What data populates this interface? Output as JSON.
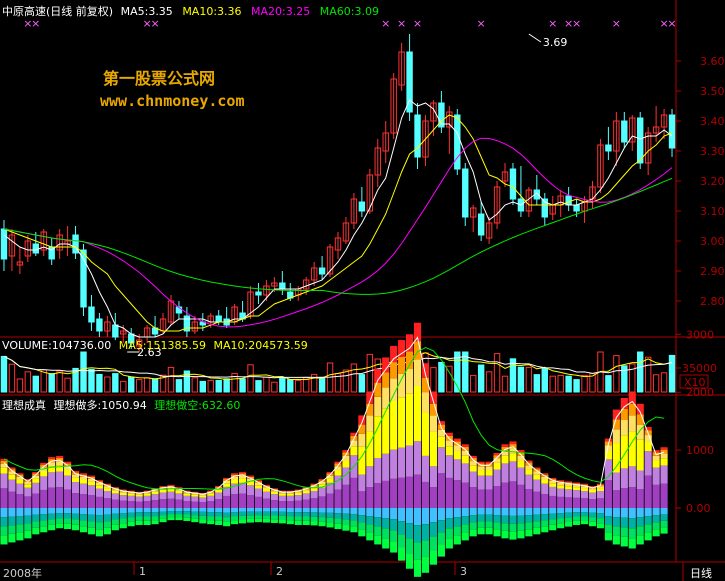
{
  "header": {
    "stock_title": "中原高速(日线 前复权)",
    "ma5": "MA5:3.35",
    "ma10": "MA10:3.36",
    "ma20": "MA20:3.25",
    "ma60": "MA60:3.09"
  },
  "watermark": {
    "line1": "第一股票公式网",
    "line2": "www.chnmoney.com"
  },
  "volume_header": {
    "volume": "VOLUME:104736.00",
    "ma5": "MA5:151385.59",
    "ma10": "MA10:204573.59"
  },
  "indicator_header": {
    "name": "理想成真",
    "long": "理想做多:1050.94",
    "short": "理想做空:632.60"
  },
  "bottom_bar": {
    "labels": [
      "2008年",
      "1",
      "2",
      "3"
    ],
    "period": "日线"
  },
  "colors": {
    "up": "#ff3232",
    "down": "#54ffff",
    "ma5": "#ffffff",
    "ma10": "#ffff00",
    "ma20": "#ff00ff",
    "ma60": "#00e600",
    "axis": "#b00000",
    "label": "#cccccc"
  },
  "chart_data": [
    {
      "type": "candlestick",
      "title": "中原高速(日线 前复权)",
      "annotations": [
        {
          "text": "3.69",
          "x": 66,
          "y": 3.69
        },
        {
          "text": "2.63",
          "x": 17,
          "y": 2.63
        }
      ],
      "ylim": [
        2.63,
        3.73
      ],
      "yticks": [
        2.8,
        2.9,
        3.0,
        3.1,
        3.2,
        3.3,
        3.4,
        3.5,
        3.6
      ],
      "ytick_labels": [
        "2.80",
        "2.90",
        "3.00",
        "3.10",
        "3.20",
        "3.30",
        "3.40",
        "3.50",
        "3.60"
      ],
      "candles": [
        [
          3.04,
          3.07,
          2.9,
          2.94
        ],
        [
          2.95,
          3.04,
          2.9,
          3.02
        ],
        [
          2.92,
          2.98,
          2.89,
          2.93
        ],
        [
          2.95,
          3.02,
          2.93,
          3.0
        ],
        [
          2.99,
          3.03,
          2.95,
          2.96
        ],
        [
          2.97,
          3.04,
          2.95,
          3.03
        ],
        [
          2.98,
          3.01,
          2.92,
          2.94
        ],
        [
          2.97,
          3.04,
          2.94,
          3.02
        ],
        [
          2.99,
          3.05,
          2.95,
          3.0
        ],
        [
          3.02,
          3.05,
          2.94,
          2.96
        ],
        [
          2.97,
          2.99,
          2.75,
          2.78
        ],
        [
          2.78,
          2.82,
          2.7,
          2.73
        ],
        [
          2.74,
          2.76,
          2.68,
          2.7
        ],
        [
          2.7,
          2.75,
          2.68,
          2.73
        ],
        [
          2.72,
          2.76,
          2.67,
          2.68
        ],
        [
          2.69,
          2.72,
          2.66,
          2.7
        ],
        [
          2.69,
          2.71,
          2.64,
          2.66
        ],
        [
          2.65,
          2.69,
          2.63,
          2.67
        ],
        [
          2.68,
          2.72,
          2.66,
          2.71
        ],
        [
          2.71,
          2.75,
          2.68,
          2.69
        ],
        [
          2.7,
          2.76,
          2.69,
          2.74
        ],
        [
          2.73,
          2.82,
          2.72,
          2.8
        ],
        [
          2.78,
          2.8,
          2.74,
          2.76
        ],
        [
          2.75,
          2.78,
          2.68,
          2.7
        ],
        [
          2.7,
          2.75,
          2.69,
          2.73
        ],
        [
          2.73,
          2.76,
          2.7,
          2.72
        ],
        [
          2.73,
          2.76,
          2.71,
          2.75
        ],
        [
          2.75,
          2.77,
          2.72,
          2.73
        ],
        [
          2.74,
          2.78,
          2.71,
          2.72
        ],
        [
          2.73,
          2.79,
          2.72,
          2.78
        ],
        [
          2.76,
          2.8,
          2.73,
          2.74
        ],
        [
          2.75,
          2.85,
          2.74,
          2.83
        ],
        [
          2.83,
          2.86,
          2.79,
          2.82
        ],
        [
          2.82,
          2.87,
          2.8,
          2.85
        ],
        [
          2.85,
          2.88,
          2.83,
          2.86
        ],
        [
          2.86,
          2.9,
          2.82,
          2.84
        ],
        [
          2.83,
          2.86,
          2.8,
          2.81
        ],
        [
          2.82,
          2.85,
          2.8,
          2.84
        ],
        [
          2.84,
          2.88,
          2.82,
          2.87
        ],
        [
          2.87,
          2.93,
          2.85,
          2.91
        ],
        [
          2.91,
          2.95,
          2.87,
          2.89
        ],
        [
          2.89,
          2.99,
          2.88,
          2.98
        ],
        [
          2.97,
          3.03,
          2.94,
          3.01
        ],
        [
          3.0,
          3.08,
          2.99,
          3.06
        ],
        [
          3.06,
          3.16,
          3.04,
          3.14
        ],
        [
          3.13,
          3.18,
          3.08,
          3.1
        ],
        [
          3.1,
          3.24,
          3.09,
          3.22
        ],
        [
          3.22,
          3.34,
          3.18,
          3.31
        ],
        [
          3.3,
          3.4,
          3.26,
          3.36
        ],
        [
          3.36,
          3.56,
          3.34,
          3.54
        ],
        [
          3.52,
          3.66,
          3.5,
          3.63
        ],
        [
          3.63,
          3.69,
          3.4,
          3.43
        ],
        [
          3.42,
          3.46,
          3.24,
          3.28
        ],
        [
          3.28,
          3.42,
          3.25,
          3.4
        ],
        [
          3.4,
          3.47,
          3.35,
          3.46
        ],
        [
          3.46,
          3.5,
          3.36,
          3.38
        ],
        [
          3.38,
          3.45,
          3.29,
          3.43
        ],
        [
          3.42,
          3.44,
          3.22,
          3.24
        ],
        [
          3.24,
          3.26,
          3.05,
          3.08
        ],
        [
          3.08,
          3.12,
          3.03,
          3.11
        ],
        [
          3.09,
          3.13,
          3.0,
          3.02
        ],
        [
          3.01,
          3.08,
          2.99,
          3.06
        ],
        [
          3.06,
          3.2,
          3.04,
          3.18
        ],
        [
          3.2,
          3.26,
          3.18,
          3.23
        ],
        [
          3.24,
          3.26,
          3.12,
          3.14
        ],
        [
          3.14,
          3.25,
          3.08,
          3.1
        ],
        [
          3.1,
          3.18,
          3.08,
          3.17
        ],
        [
          3.17,
          3.22,
          3.12,
          3.14
        ],
        [
          3.14,
          3.16,
          3.05,
          3.08
        ],
        [
          3.09,
          3.15,
          3.07,
          3.12
        ],
        [
          3.12,
          3.17,
          3.08,
          3.15
        ],
        [
          3.15,
          3.18,
          3.1,
          3.12
        ],
        [
          3.12,
          3.14,
          3.08,
          3.1
        ],
        [
          3.1,
          3.15,
          3.06,
          3.13
        ],
        [
          3.14,
          3.2,
          3.11,
          3.18
        ],
        [
          3.18,
          3.34,
          3.16,
          3.32
        ],
        [
          3.32,
          3.38,
          3.27,
          3.3
        ],
        [
          3.3,
          3.43,
          3.25,
          3.4
        ],
        [
          3.4,
          3.43,
          3.31,
          3.33
        ],
        [
          3.33,
          3.42,
          3.3,
          3.41
        ],
        [
          3.41,
          3.43,
          3.24,
          3.26
        ],
        [
          3.26,
          3.38,
          3.22,
          3.36
        ],
        [
          3.36,
          3.45,
          3.33,
          3.38
        ],
        [
          3.38,
          3.44,
          3.34,
          3.42
        ],
        [
          3.42,
          3.44,
          3.28,
          3.31
        ]
      ],
      "ma5": [
        3.02,
        3.0,
        2.98,
        2.97,
        2.97,
        2.98,
        2.97,
        2.99,
        2.99,
        2.98,
        2.94,
        2.89,
        2.83,
        2.78,
        2.72,
        2.71,
        2.69,
        2.68,
        2.68,
        2.68,
        2.69,
        2.72,
        2.74,
        2.74,
        2.74,
        2.74,
        2.73,
        2.73,
        2.73,
        2.74,
        2.74,
        2.76,
        2.78,
        2.81,
        2.84,
        2.84,
        2.84,
        2.84,
        2.85,
        2.86,
        2.87,
        2.9,
        2.93,
        2.97,
        3.02,
        3.06,
        3.11,
        3.17,
        3.21,
        3.31,
        3.41,
        3.47,
        3.45,
        3.46,
        3.44,
        3.39,
        3.39,
        3.36,
        3.29,
        3.23,
        3.13,
        3.07,
        3.09,
        3.12,
        3.13,
        3.12,
        3.14,
        3.16,
        3.13,
        3.12,
        3.13,
        3.12,
        3.12,
        3.13,
        3.14,
        3.17,
        3.21,
        3.26,
        3.31,
        3.35,
        3.34,
        3.35,
        3.35,
        3.37,
        3.35
      ],
      "ma10": [
        3.04,
        3.03,
        3.02,
        3.01,
        3.0,
        2.99,
        2.98,
        2.98,
        2.98,
        2.98,
        2.96,
        2.93,
        2.91,
        2.89,
        2.85,
        2.82,
        2.79,
        2.76,
        2.73,
        2.71,
        2.7,
        2.7,
        2.7,
        2.71,
        2.71,
        2.71,
        2.72,
        2.73,
        2.73,
        2.73,
        2.74,
        2.75,
        2.75,
        2.77,
        2.79,
        2.8,
        2.81,
        2.82,
        2.83,
        2.84,
        2.85,
        2.87,
        2.89,
        2.91,
        2.93,
        2.95,
        2.99,
        3.04,
        3.09,
        3.16,
        3.23,
        3.29,
        3.31,
        3.34,
        3.37,
        3.4,
        3.42,
        3.41,
        3.38,
        3.34,
        3.28,
        3.22,
        3.21,
        3.19,
        3.18,
        3.15,
        3.12,
        3.12,
        3.12,
        3.12,
        3.12,
        3.13,
        3.14,
        3.13,
        3.13,
        3.14,
        3.16,
        3.19,
        3.22,
        3.25,
        3.27,
        3.3,
        3.32,
        3.35,
        3.36
      ]
    },
    {
      "type": "bar",
      "title": "VOLUME:104736.00",
      "series": [
        {
          "name": "MA5",
          "value_label": "MA5:151385.59"
        },
        {
          "name": "MA10",
          "value_label": "MA10:204573.59"
        }
      ],
      "yticks": [
        35000
      ],
      "ytick_labels": [
        "35000"
      ],
      "scale_label": "X10"
    },
    {
      "type": "bar",
      "title": "理想成真",
      "series": [
        {
          "name": "理想做多",
          "last": 1050.94
        },
        {
          "name": "理想做空",
          "last": 632.6
        }
      ],
      "ylim": [
        -1800,
        3400
      ],
      "yticks": [
        3000,
        2000,
        1000,
        0
      ],
      "ytick_labels": [
        "3000",
        "2000",
        "1000",
        "0.00"
      ],
      "long_values": [
        850,
        700,
        600,
        500,
        620,
        780,
        880,
        900,
        800,
        640,
        600,
        560,
        480,
        420,
        360,
        320,
        300,
        280,
        300,
        340,
        380,
        400,
        360,
        300,
        280,
        260,
        300,
        380,
        520,
        600,
        620,
        560,
        480,
        400,
        340,
        300,
        300,
        320,
        360,
        420,
        500,
        620,
        800,
        1000,
        1300,
        1600,
        2000,
        2400,
        2600,
        2800,
        2900,
        3000,
        3200,
        2500,
        2000,
        1500,
        1300,
        1200,
        1100,
        900,
        800,
        800,
        950,
        1100,
        1150,
        1000,
        820,
        700,
        600,
        520,
        480,
        460,
        440,
        420,
        380,
        420,
        1200,
        1700,
        1900,
        2000,
        1800,
        1400,
        1000,
        1050
      ],
      "short_values": [
        -900,
        -850,
        -800,
        -750,
        -650,
        -600,
        -550,
        -500,
        -520,
        -550,
        -600,
        -650,
        -700,
        -650,
        -550,
        -500,
        -450,
        -420,
        -420,
        -400,
        -350,
        -300,
        -300,
        -320,
        -350,
        -380,
        -400,
        -420,
        -450,
        -400,
        -380,
        -360,
        -350,
        -360,
        -370,
        -380,
        -400,
        -420,
        -420,
        -430,
        -450,
        -480,
        -520,
        -560,
        -600,
        -700,
        -800,
        -900,
        -1000,
        -1100,
        -1300,
        -1500,
        -1700,
        -1600,
        -1400,
        -1200,
        -1000,
        -900,
        -800,
        -700,
        -650,
        -650,
        -700,
        -750,
        -780,
        -750,
        -700,
        -650,
        -600,
        -550,
        -500,
        -460,
        -420,
        -400,
        -450,
        -500,
        -800,
        -900,
        -950,
        -1000,
        -900,
        -800,
        -700,
        -632
      ]
    }
  ]
}
